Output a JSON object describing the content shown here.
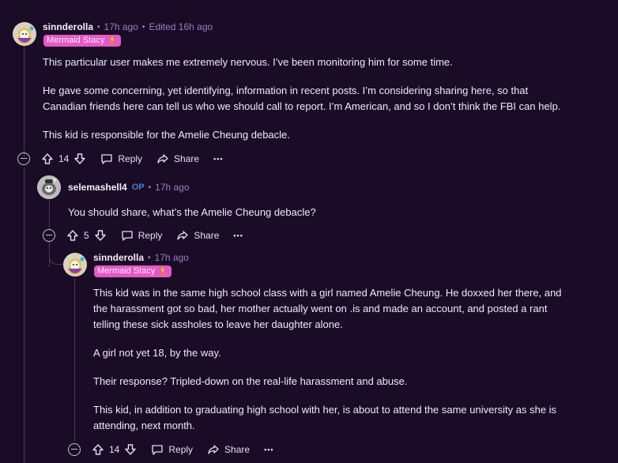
{
  "comments": [
    {
      "username": "sinnderolla",
      "time": "17h ago",
      "edited": "Edited 16h ago",
      "flair": "Mermaid Stacy",
      "paragraphs": [
        "This particular user makes me extremely nervous. I’ve been monitoring him for some time.",
        "He gave some concerning, yet identifying, information in recent posts. I’m considering sharing here, so that",
        "Canadian friends here can tell us who we should call to report. I’m American, and so I don’t think the FBI can help.",
        "This kid is responsible for the Amelie Cheung debacle."
      ],
      "votes": "14",
      "reply_label": "Reply",
      "share_label": "Share",
      "more_label": "•••"
    },
    {
      "username": "selemashell4",
      "op_badge": "OP",
      "time": "17h ago",
      "paragraphs": [
        "You should share, what’s the Amelie Cheung debacle?"
      ],
      "votes": "5",
      "reply_label": "Reply",
      "share_label": "Share",
      "more_label": "•••"
    },
    {
      "username": "sinnderolla",
      "time": "17h ago",
      "flair": "Mermaid Stacy",
      "paragraphs": [
        "This kid was in the same high school class with a girl named Amelie Cheung. He doxxed her there, and",
        "the harassment got so bad, her mother actually went on .is and made an account, and posted a rant",
        "telling these sick assholes to leave her daughter alone.",
        "A girl not yet 18, by the way.",
        "Their response? Tripled-down on the real-life harassment and abuse.",
        "This kid, in addition to graduating high school with her, is about to attend the same university as she is",
        "attending, next month."
      ],
      "votes": "14",
      "reply_label": "Reply",
      "share_label": "Share",
      "more_label": "•••"
    }
  ],
  "colors": {
    "background": "#1a0b26",
    "flair_bg": "#e15ac6",
    "timestamp": "#9e7cc0",
    "op_badge": "#4b7bd6"
  },
  "icons": [
    "avatar",
    "upvote-icon",
    "downvote-icon",
    "comment-icon",
    "share-icon",
    "more-icon",
    "collapse-icon",
    "mermaid-emoji-icon"
  ]
}
